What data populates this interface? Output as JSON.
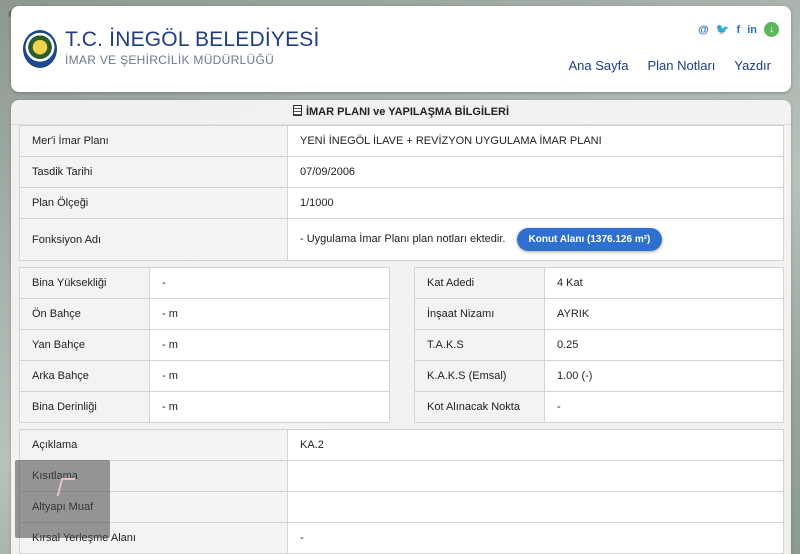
{
  "listing_id": "#1320568869",
  "header": {
    "title": "T.C. İNEGÖL BELEDİYESİ",
    "subtitle": "İMAR VE ŞEHİRCİLİK MÜDÜRLÜĞÜ",
    "social": [
      "@",
      "twitter",
      "f",
      "in",
      "download"
    ],
    "nav": [
      "Ana Sayfa",
      "Plan Notları",
      "Yazdır"
    ]
  },
  "panel": {
    "title": "İMAR PLANI ve YAPILAŞMA BİLGİLERİ",
    "top_rows": [
      {
        "label": "Mer'i İmar Planı",
        "value": "YENİ İNEGÖL İLAVE + REVİZYON UYGULAMA İMAR PLANI"
      },
      {
        "label": "Tasdik Tarihi",
        "value": "07/09/2006"
      },
      {
        "label": "Plan Ölçeği",
        "value": "1/1000"
      },
      {
        "label": "Fonksiyon Adı",
        "value": "- Uygulama İmar Planı plan notları ektedir.",
        "badge": "Konut Alanı (1376.126 m²)"
      }
    ],
    "left_rows": [
      {
        "label": "Bina Yüksekliği",
        "value": "-"
      },
      {
        "label": "Ön Bahçe",
        "value": "- m"
      },
      {
        "label": "Yan Bahçe",
        "value": "- m"
      },
      {
        "label": "Arka Bahçe",
        "value": "- m"
      },
      {
        "label": "Bina Derinliği",
        "value": "- m"
      }
    ],
    "right_rows": [
      {
        "label": "Kat Adedi",
        "value": "4 Kat"
      },
      {
        "label": "İnşaat Nizamı",
        "value": "AYRIK"
      },
      {
        "label": "T.A.K.S",
        "value": "0.25"
      },
      {
        "label": "K.A.K.S (Emsal)",
        "value": "1.00 (-)"
      },
      {
        "label": "Kot Alınacak Nokta",
        "value": "-"
      }
    ],
    "bottom_rows": [
      {
        "label": "Açıklama",
        "value": "KA.2"
      },
      {
        "label": "Kısıtlama",
        "value": ""
      },
      {
        "label": "Altyapı Muaf",
        "value": ""
      },
      {
        "label": "Kırsal Yerleşme Alanı",
        "value": "-"
      }
    ]
  },
  "colors": {
    "brand_blue": "#1f3c88",
    "badge_blue": "#2e6fd0",
    "download_green": "#5cb85c"
  }
}
